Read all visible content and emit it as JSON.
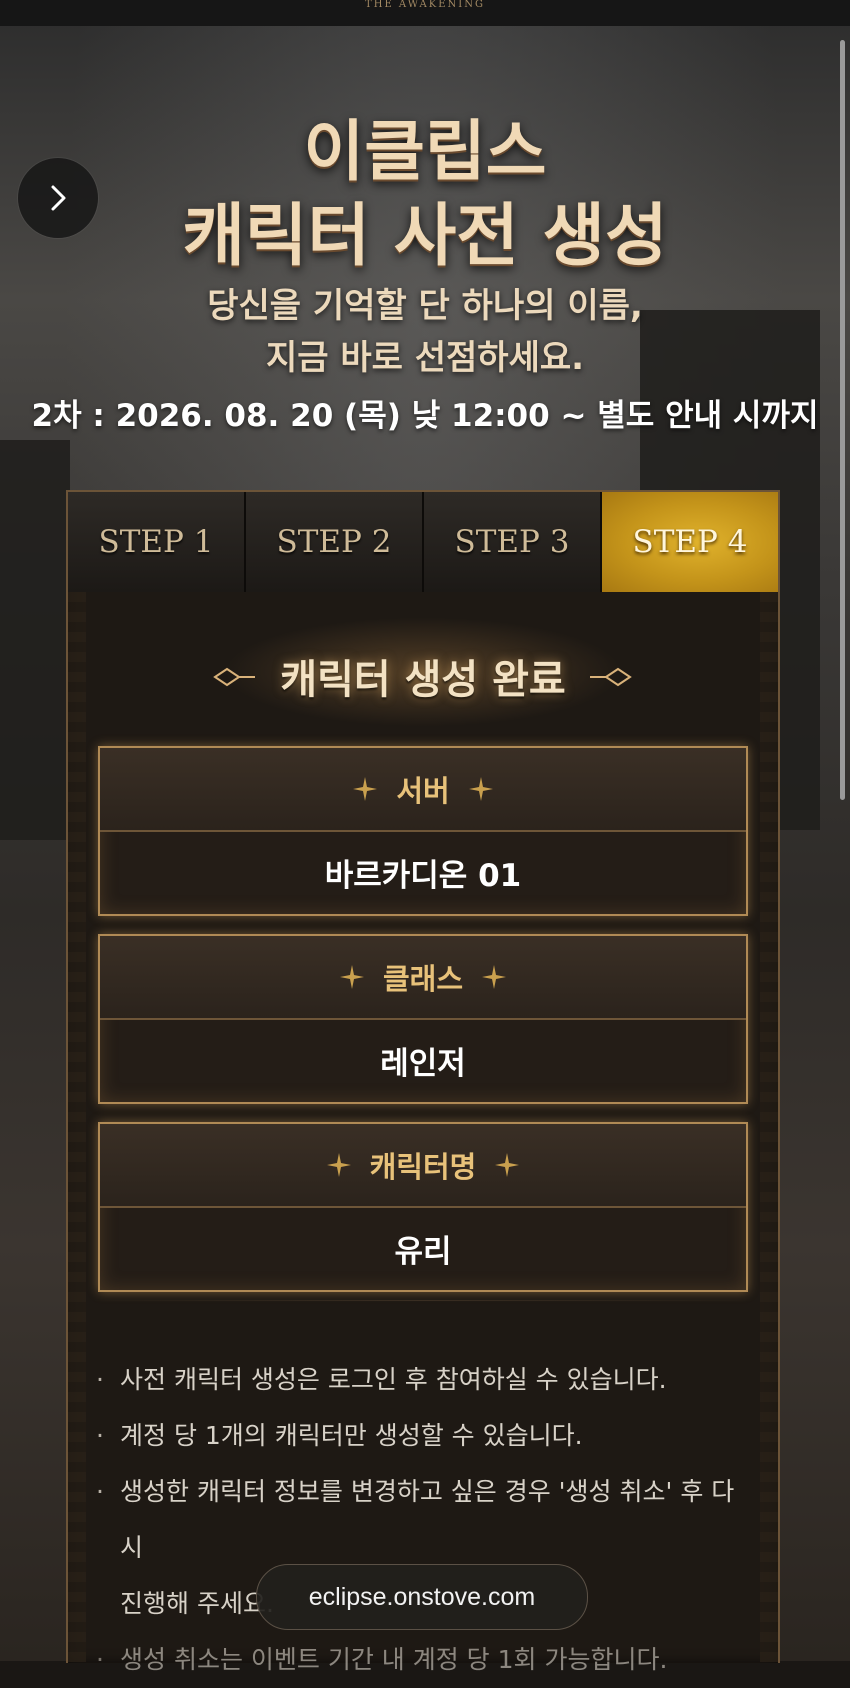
{
  "brand": "THE AWAKENING",
  "title_line1": "이클립스",
  "title_line2": "캐릭터 사전 생성",
  "subtitle_line1": "당신을 기억할 단 하나의 이름,",
  "subtitle_line2": "지금 바로 선점하세요.",
  "date_text": "2차 : 2026. 08. 20 (목) 낮 12:00 ~ 별도 안내 시까지",
  "tabs": [
    {
      "label": "STEP 1",
      "active": false
    },
    {
      "label": "STEP 2",
      "active": false
    },
    {
      "label": "STEP 3",
      "active": false
    },
    {
      "label": "STEP 4",
      "active": true
    }
  ],
  "section_title": "캐릭터 생성 완료",
  "cards": [
    {
      "label": "서버",
      "value": "바르카디온 01"
    },
    {
      "label": "클래스",
      "value": "레인저"
    },
    {
      "label": "캐릭터명",
      "value": "유리"
    }
  ],
  "notes": [
    "사전 캐릭터 생성은 로그인 후 참여하실 수 있습니다.",
    "계정 당 1개의 캐릭터만 생성할 수 있습니다.",
    "생성한 캐릭터 정보를 변경하고 싶은 경우 '생성 취소' 후 다시",
    "진행해 주세요.",
    "생성 취소는 이벤트 기간 내 계정 당 1회 가능합니다."
  ],
  "url": "eclipse.onstove.com",
  "colors": {
    "accent_gold": "#c4941a",
    "label_gold": "#e8c27a"
  }
}
